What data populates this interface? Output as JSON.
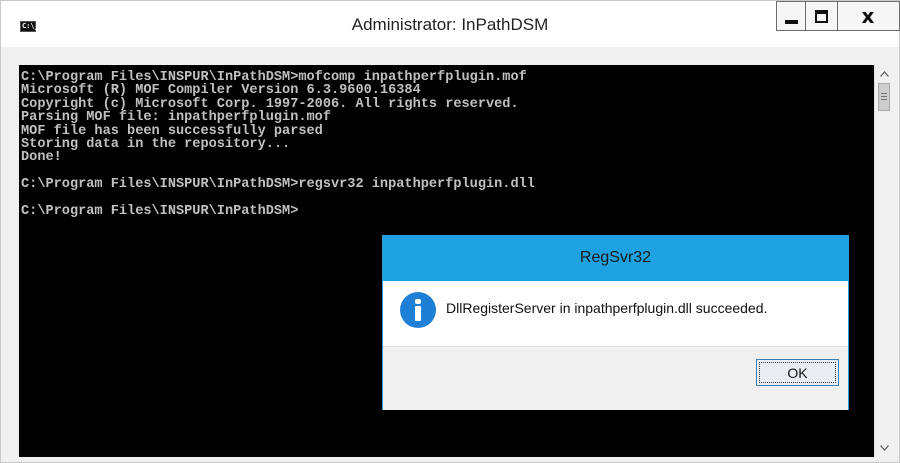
{
  "window": {
    "title": "Administrator: InPathDSM",
    "icon_label": "C:\\_",
    "buttons": {
      "minimize": "minimize",
      "maximize": "maximize",
      "close": "x"
    }
  },
  "console": {
    "lines": [
      "C:\\Program Files\\INSPUR\\InPathDSM>mofcomp inpathperfplugin.mof",
      "Microsoft (R) MOF Compiler Version 6.3.9600.16384",
      "Copyright (c) Microsoft Corp. 1997-2006. All rights reserved.",
      "Parsing MOF file: inpathperfplugin.mof",
      "MOF file has been successfully parsed",
      "Storing data in the repository...",
      "Done!",
      "",
      "C:\\Program Files\\INSPUR\\InPathDSM>regsvr32 inpathperfplugin.dll",
      "",
      "C:\\Program Files\\INSPUR\\InPathDSM>"
    ],
    "text_color": "#c0c0c0",
    "background": "#000000"
  },
  "scrollbar": {
    "up_arrow": "^",
    "down_arrow": "v"
  },
  "dialog": {
    "title": "RegSvr32",
    "icon": "info-icon",
    "message": "DllRegisterServer in inpathperfplugin.dll succeeded.",
    "ok_label": "OK",
    "title_color": "#1da1e0",
    "icon_color": "#1e7fd6"
  }
}
